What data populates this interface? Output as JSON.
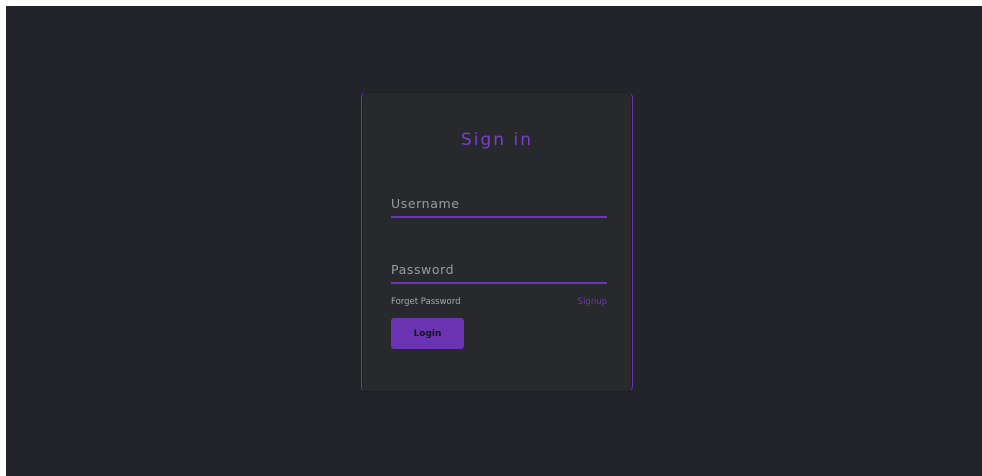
{
  "signin": {
    "title": "Sign in",
    "username_placeholder": "Username",
    "password_placeholder": "Password",
    "forget_label": "Forget Password",
    "signup_label": "Signup",
    "login_label": "Login"
  },
  "colors": {
    "page_bg": "#23242a",
    "card_bg": "#28292d",
    "accent": "#6b35b8"
  }
}
